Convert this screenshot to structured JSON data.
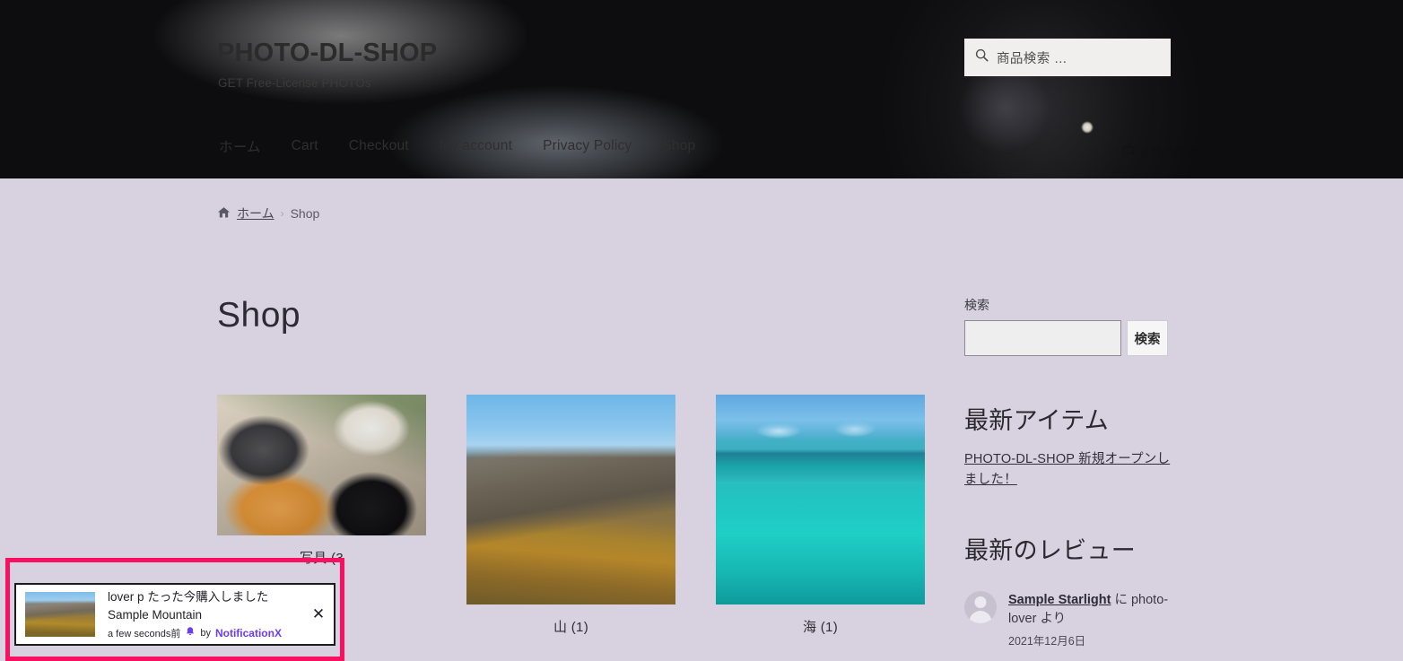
{
  "header": {
    "site_title": "PHOTO-DL-SHOP",
    "tagline": "GET Free-License PHOTOs",
    "product_search_placeholder": "商品検索 …",
    "search_icon": "search-icon",
    "cart_label": "0 個の商品",
    "cart_icon": "shopping-basket-icon",
    "nav": [
      {
        "label": "ホーム"
      },
      {
        "label": "Cart"
      },
      {
        "label": "Checkout"
      },
      {
        "label": "My account"
      },
      {
        "label": "Privacy Policy"
      },
      {
        "label": "Shop"
      }
    ]
  },
  "breadcrumb": {
    "home_icon": "home-icon",
    "home_label": "ホーム",
    "separator": "›",
    "current": "Shop"
  },
  "main": {
    "page_title": "Shop",
    "categories": [
      {
        "label": "写具 (3",
        "image": "desk-flatlay-camera-coffee-notebook"
      },
      {
        "label": "山 (1)",
        "image": "autumn-mountain-ridge"
      },
      {
        "label": "海 (1)",
        "image": "tropical-turquoise-ocean"
      }
    ]
  },
  "sidebar": {
    "search_widget": {
      "label": "検索",
      "input_value": "",
      "button_label": "検索"
    },
    "latest_items": {
      "title": "最新アイテム",
      "links": [
        {
          "label": "PHOTO-DL-SHOP 新規オープンしました！"
        }
      ]
    },
    "latest_reviews": {
      "title": "最新のレビュー",
      "items": [
        {
          "avatar": "default-user-avatar",
          "product": "Sample Starlight",
          "text_middle": " に photo-lover より",
          "date": "2021年12月6日"
        }
      ]
    }
  },
  "notification": {
    "thumb": "mountain-thumbnail",
    "line1": "lover p たった今購入しました",
    "line2": "Sample Mountain",
    "time": "a few seconds前",
    "bell_icon": "bell-icon",
    "by_label": "by",
    "brand": "NotificationX",
    "close_icon": "close-icon",
    "highlight_color": "#fa1060"
  }
}
